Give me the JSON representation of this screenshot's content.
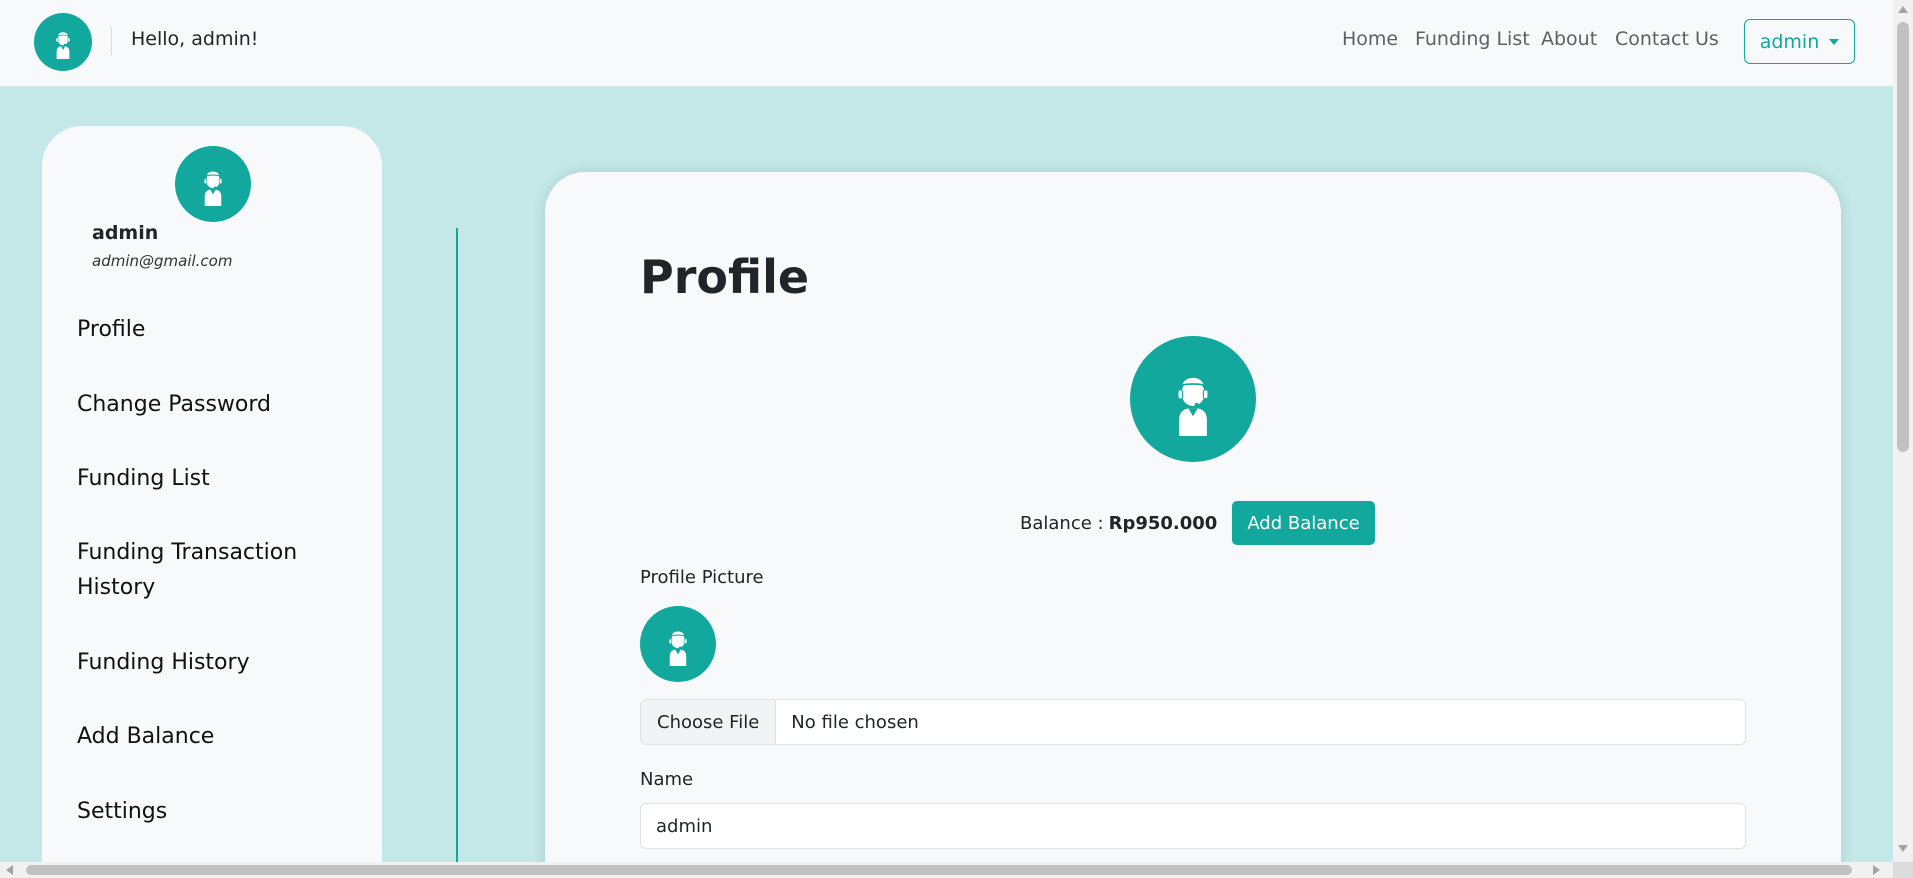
{
  "navbar": {
    "greeting": "Hello, admin!",
    "links": [
      "Home",
      "Funding List",
      "About",
      "Contact Us"
    ],
    "user_menu_label": "admin"
  },
  "sidebar": {
    "name": "admin",
    "email": "admin@gmail.com",
    "items": [
      {
        "label": "Profile"
      },
      {
        "label": "Change Password"
      },
      {
        "label": "Funding List"
      },
      {
        "label": "Funding Transaction History"
      },
      {
        "label": "Funding History"
      },
      {
        "label": "Add Balance"
      },
      {
        "label": "Settings"
      }
    ]
  },
  "main": {
    "title": "Profile",
    "balance_label": "Balance :",
    "balance_amount": "Rp950.000",
    "add_balance_label": "Add Balance",
    "profile_picture_label": "Profile Picture",
    "file_button_label": "Choose File",
    "file_status": "No file chosen",
    "name_label": "Name",
    "name_value": "admin"
  },
  "colors": {
    "accent": "#12a89e",
    "background": "#c4e8e8",
    "surface": "#f8f9fa"
  },
  "icons": {
    "avatar": "user-headset-icon"
  }
}
